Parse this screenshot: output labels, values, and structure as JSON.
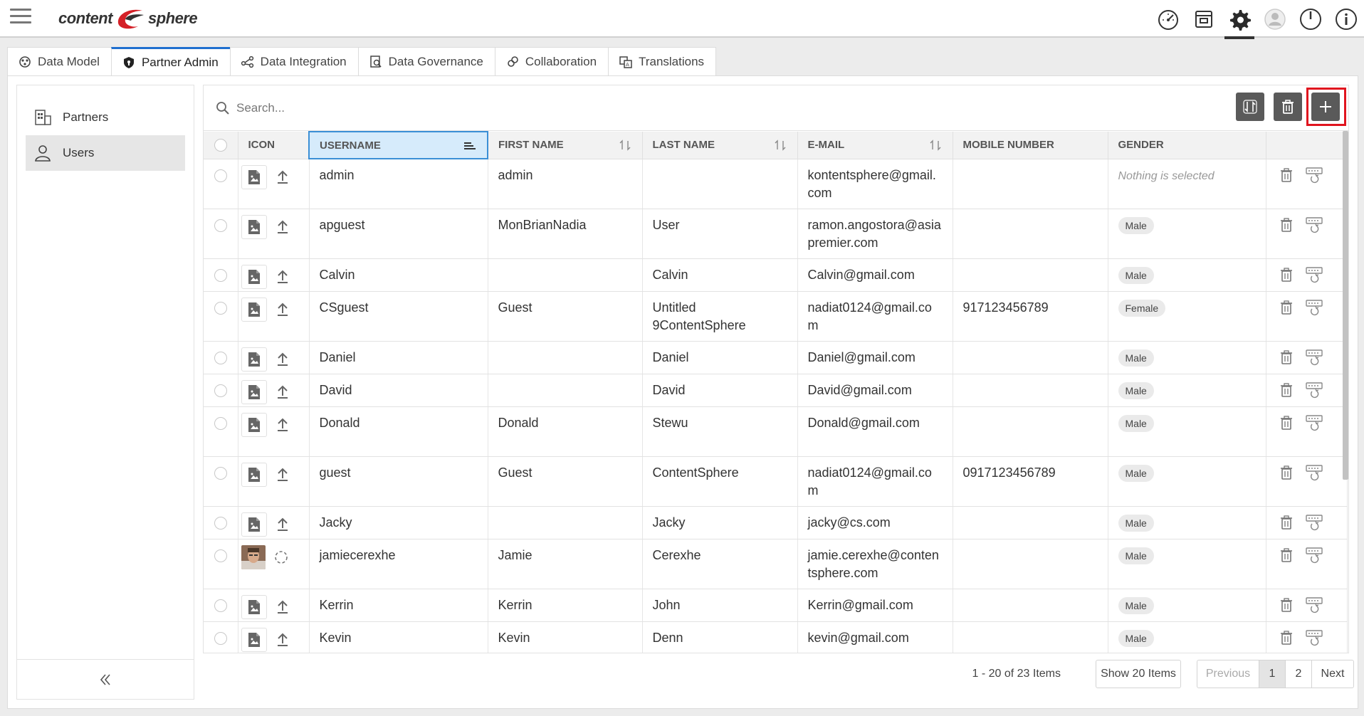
{
  "app": {
    "logo_left": "content",
    "logo_right": "sphere"
  },
  "tabs": [
    {
      "label": "Data Model",
      "icon": "data-model-icon"
    },
    {
      "label": "Partner Admin",
      "icon": "shield-icon"
    },
    {
      "label": "Data Integration",
      "icon": "integration-icon"
    },
    {
      "label": "Data Governance",
      "icon": "governance-icon"
    },
    {
      "label": "Collaboration",
      "icon": "collaboration-icon"
    },
    {
      "label": "Translations",
      "icon": "translations-icon"
    }
  ],
  "sidebar": {
    "items": [
      {
        "label": "Partners",
        "icon": "partners-icon"
      },
      {
        "label": "Users",
        "icon": "user-icon"
      }
    ]
  },
  "search": {
    "placeholder": "Search..."
  },
  "columns": {
    "icon": "ICON",
    "username": "USERNAME",
    "first_name": "FIRST NAME",
    "last_name": "LAST NAME",
    "email": "E-MAIL",
    "mobile": "MOBILE NUMBER",
    "gender": "GENDER"
  },
  "gender_placeholder": "Nothing is selected",
  "rows": [
    {
      "username": "admin",
      "first_name": "admin",
      "last_name": "",
      "email": "kontentsphere@gmail.com",
      "mobile": "",
      "gender": "",
      "tall": true,
      "avatar": false
    },
    {
      "username": "apguest",
      "first_name": "MonBrianNadia",
      "last_name": "User",
      "email": "ramon.angostora@asiapremier.com",
      "mobile": "",
      "gender": "Male",
      "tall": true,
      "avatar": false
    },
    {
      "username": "Calvin",
      "first_name": "",
      "last_name": "Calvin",
      "email": "Calvin@gmail.com",
      "mobile": "",
      "gender": "Male",
      "tall": false,
      "avatar": false
    },
    {
      "username": "CSguest",
      "first_name": "Guest",
      "last_name": "Untitled 9ContentSphere",
      "email": "nadiat0124@gmail.com",
      "mobile": "917123456789",
      "gender": "Female",
      "tall": true,
      "avatar": false
    },
    {
      "username": "Daniel",
      "first_name": "",
      "last_name": "Daniel",
      "email": "Daniel@gmail.com",
      "mobile": "",
      "gender": "Male",
      "tall": false,
      "avatar": false
    },
    {
      "username": "David",
      "first_name": "",
      "last_name": "David",
      "email": "David@gmail.com",
      "mobile": "",
      "gender": "Male",
      "tall": false,
      "avatar": false
    },
    {
      "username": "Donald",
      "first_name": "Donald",
      "last_name": "Stewu",
      "email": "Donald@gmail.com",
      "mobile": "",
      "gender": "Male",
      "tall": true,
      "avatar": false
    },
    {
      "username": "guest",
      "first_name": "Guest",
      "last_name": "ContentSphere",
      "email": "nadiat0124@gmail.com",
      "mobile": "0917123456789",
      "gender": "Male",
      "tall": true,
      "avatar": false
    },
    {
      "username": "Jacky",
      "first_name": "",
      "last_name": "Jacky",
      "email": "jacky@cs.com",
      "mobile": "",
      "gender": "Male",
      "tall": false,
      "avatar": false
    },
    {
      "username": "jamiecerexhe",
      "first_name": "Jamie",
      "last_name": "Cerexhe",
      "email": "jamie.cerexhe@contentsphere.com",
      "mobile": "",
      "gender": "Male",
      "tall": true,
      "avatar": true
    },
    {
      "username": "Kerrin",
      "first_name": "Kerrin",
      "last_name": "John",
      "email": "Kerrin@gmail.com",
      "mobile": "",
      "gender": "Male",
      "tall": false,
      "avatar": false
    },
    {
      "username": "Kevin",
      "first_name": "Kevin",
      "last_name": "Denn",
      "email": "kevin@gmail.com",
      "mobile": "",
      "gender": "Male",
      "tall": false,
      "avatar": false
    }
  ],
  "pager": {
    "info": "1 - 20 of 23 Items",
    "show": "Show 20 Items",
    "previous": "Previous",
    "page1": "1",
    "page2": "2",
    "next": "Next"
  },
  "colors": {
    "accent": "#1f6fcf",
    "highlight": "#e0141e",
    "toolbar_button": "#5a5a5a",
    "logo_red": "#d42027"
  }
}
